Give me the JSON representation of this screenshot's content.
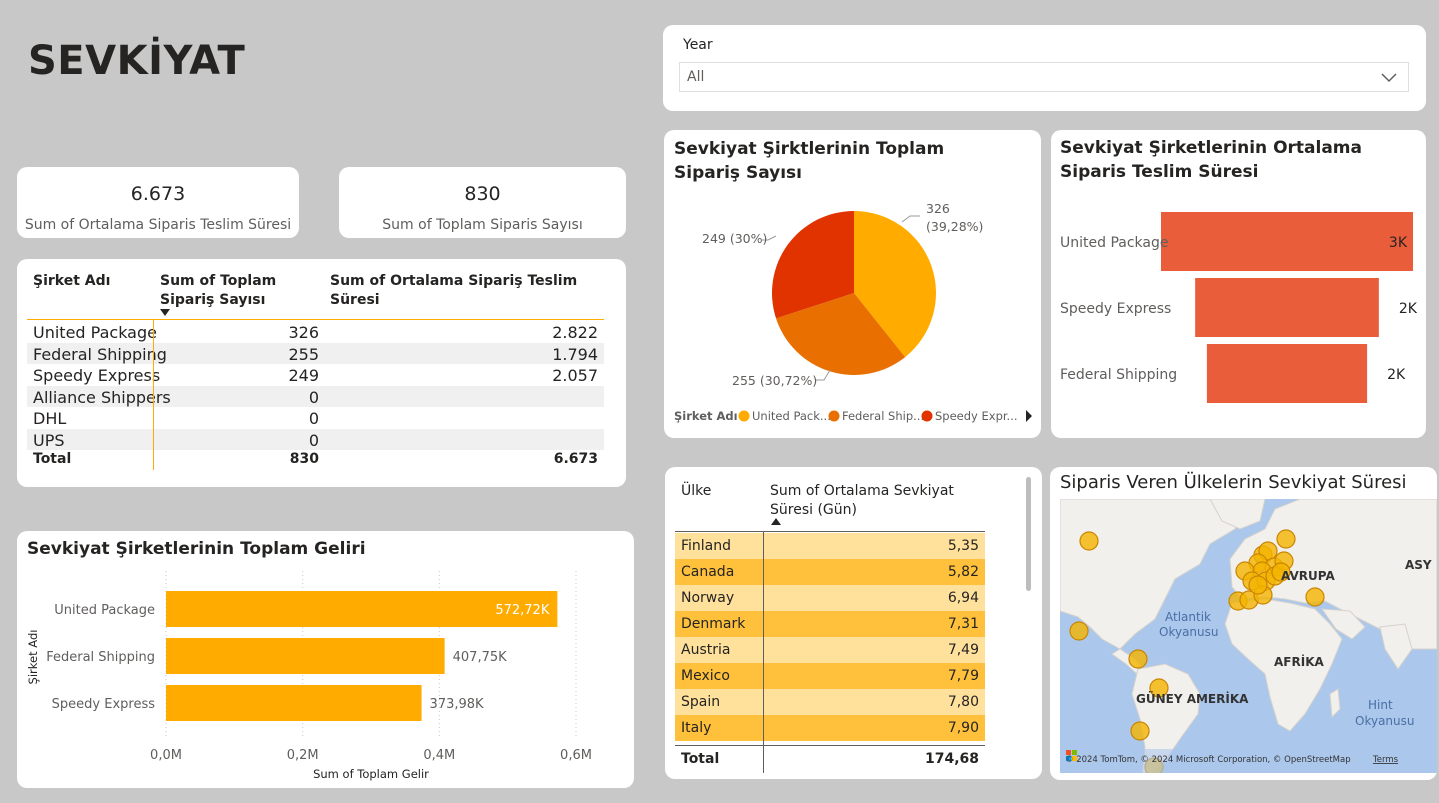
{
  "page_title": "SEVKİYAT",
  "kpi1": {
    "value": "6.673",
    "label": "Sum of Ortalama Siparis Teslim Süresi"
  },
  "kpi2": {
    "value": "830",
    "label": "Sum of Toplam Siparis Sayısı"
  },
  "slicer": {
    "label": "Year",
    "value": "All"
  },
  "company_table": {
    "headers": [
      "Şirket Adı",
      "Sum of Toplam Sipariş Sayısı",
      "Sum of Ortalama Sipariş Teslim Süresi"
    ],
    "rows": [
      {
        "name": "United Package",
        "orders": "326",
        "avg": "2.822"
      },
      {
        "name": "Federal Shipping",
        "orders": "255",
        "avg": "1.794"
      },
      {
        "name": "Speedy Express",
        "orders": "249",
        "avg": "2.057"
      },
      {
        "name": "Alliance Shippers",
        "orders": "0",
        "avg": ""
      },
      {
        "name": "DHL",
        "orders": "0",
        "avg": ""
      },
      {
        "name": "UPS",
        "orders": "0",
        "avg": ""
      }
    ],
    "total": {
      "label": "Total",
      "orders": "830",
      "avg": "6.673"
    }
  },
  "pie": {
    "title": "Sevkiyat Şirktlerinin Toplam Sipariş Sayısı",
    "legend_title": "Şirket Adı",
    "legend_items": [
      "United Pack...",
      "Federal Ship...",
      "Speedy Expr..."
    ],
    "labels": {
      "united_a": "326",
      "united_b": "(39,28%)",
      "federal": "255 (30,72%)",
      "speedy": "249 (30%)"
    }
  },
  "funnel": {
    "title": "Sevkiyat Şirketlerinin Ortalama Siparis Teslim Süresi"
  },
  "revenue": {
    "title": "Sevkiyat Şirketlerinin Toplam Geliri"
  },
  "country_table": {
    "headers": [
      "Ülke",
      "Sum of Ortalama Sevkiyat Süresi (Gün)"
    ],
    "rows": [
      {
        "country": "Finland",
        "value": "5,35"
      },
      {
        "country": "Canada",
        "value": "5,82"
      },
      {
        "country": "Norway",
        "value": "6,94"
      },
      {
        "country": "Denmark",
        "value": "7,31"
      },
      {
        "country": "Austria",
        "value": "7,49"
      },
      {
        "country": "Mexico",
        "value": "7,79"
      },
      {
        "country": "Spain",
        "value": "7,80"
      },
      {
        "country": "Italy",
        "value": "7,90"
      }
    ],
    "total": {
      "label": "Total",
      "value": "174,68"
    }
  },
  "map": {
    "title": "Siparis Veren Ülkelerin Sevkiyat Süresi",
    "labels": {
      "avrupa": "AVRUPA",
      "asya": "ASY",
      "atlantic1": "Atlantik",
      "atlantic2": "Okyanusu",
      "afrika": "AFRİKA",
      "guney": "GÜNEY AMERİKA",
      "hint1": "Hint",
      "hint2": "Okyanusu"
    },
    "attribution": "© 2024 TomTom, © 2024 Microsoft Corporation, © OpenStreetMap",
    "terms": "Terms"
  },
  "chart_data": [
    {
      "type": "pie",
      "title": "Sevkiyat Şirktlerinin Toplam Sipariş Sayısı",
      "legend_title": "Şirket Adı",
      "categories": [
        "United Package",
        "Federal Shipping",
        "Speedy Express"
      ],
      "values": [
        326,
        255,
        249
      ],
      "percent_labels": [
        "39,28%",
        "30,72%",
        "30%"
      ],
      "colors": [
        "#ffab00",
        "#e97000",
        "#e03300"
      ],
      "legend": "bottom"
    },
    {
      "type": "bar",
      "orientation": "horizontal",
      "title": "Sevkiyat Şirketlerinin Ortalama Siparis Teslim Süresi",
      "categories": [
        "United Package",
        "Speedy Express",
        "Federal Shipping"
      ],
      "values": [
        2822,
        2057,
        1794
      ],
      "data_labels": [
        "3K",
        "2K",
        "2K"
      ],
      "color": "#e95d3a"
    },
    {
      "type": "bar",
      "orientation": "horizontal",
      "title": "Sevkiyat Şirketlerinin Toplam Geliri",
      "categories": [
        "United Package",
        "Federal Shipping",
        "Speedy Express"
      ],
      "values": [
        572720,
        407750,
        373980
      ],
      "data_labels": [
        "572,72K",
        "407,75K",
        "373,98K"
      ],
      "xlabel": "Sum of Toplam Gelir",
      "ylabel": "Şirket Adı",
      "xticks": [
        "0,0M",
        "0,2M",
        "0,4M",
        "0,6M"
      ],
      "xlim": [
        0,
        600000
      ],
      "grid": true,
      "color": "#ffab00"
    }
  ]
}
